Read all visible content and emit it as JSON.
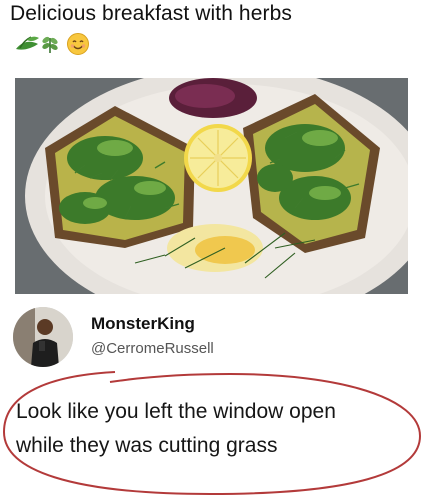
{
  "post": {
    "title": "Delicious breakfast with herbs",
    "emojis": [
      "herb-icon",
      "herb-icon",
      "smiling-face-icon"
    ]
  },
  "reply": {
    "display_name": "MonsterKing",
    "handle": "@CerromeRussell",
    "text_line1": "Look like you left the window open",
    "text_line2": "while they was cutting grass"
  },
  "colors": {
    "annotation_circle": "#b33a3a",
    "photo_background": "#6f7376"
  }
}
